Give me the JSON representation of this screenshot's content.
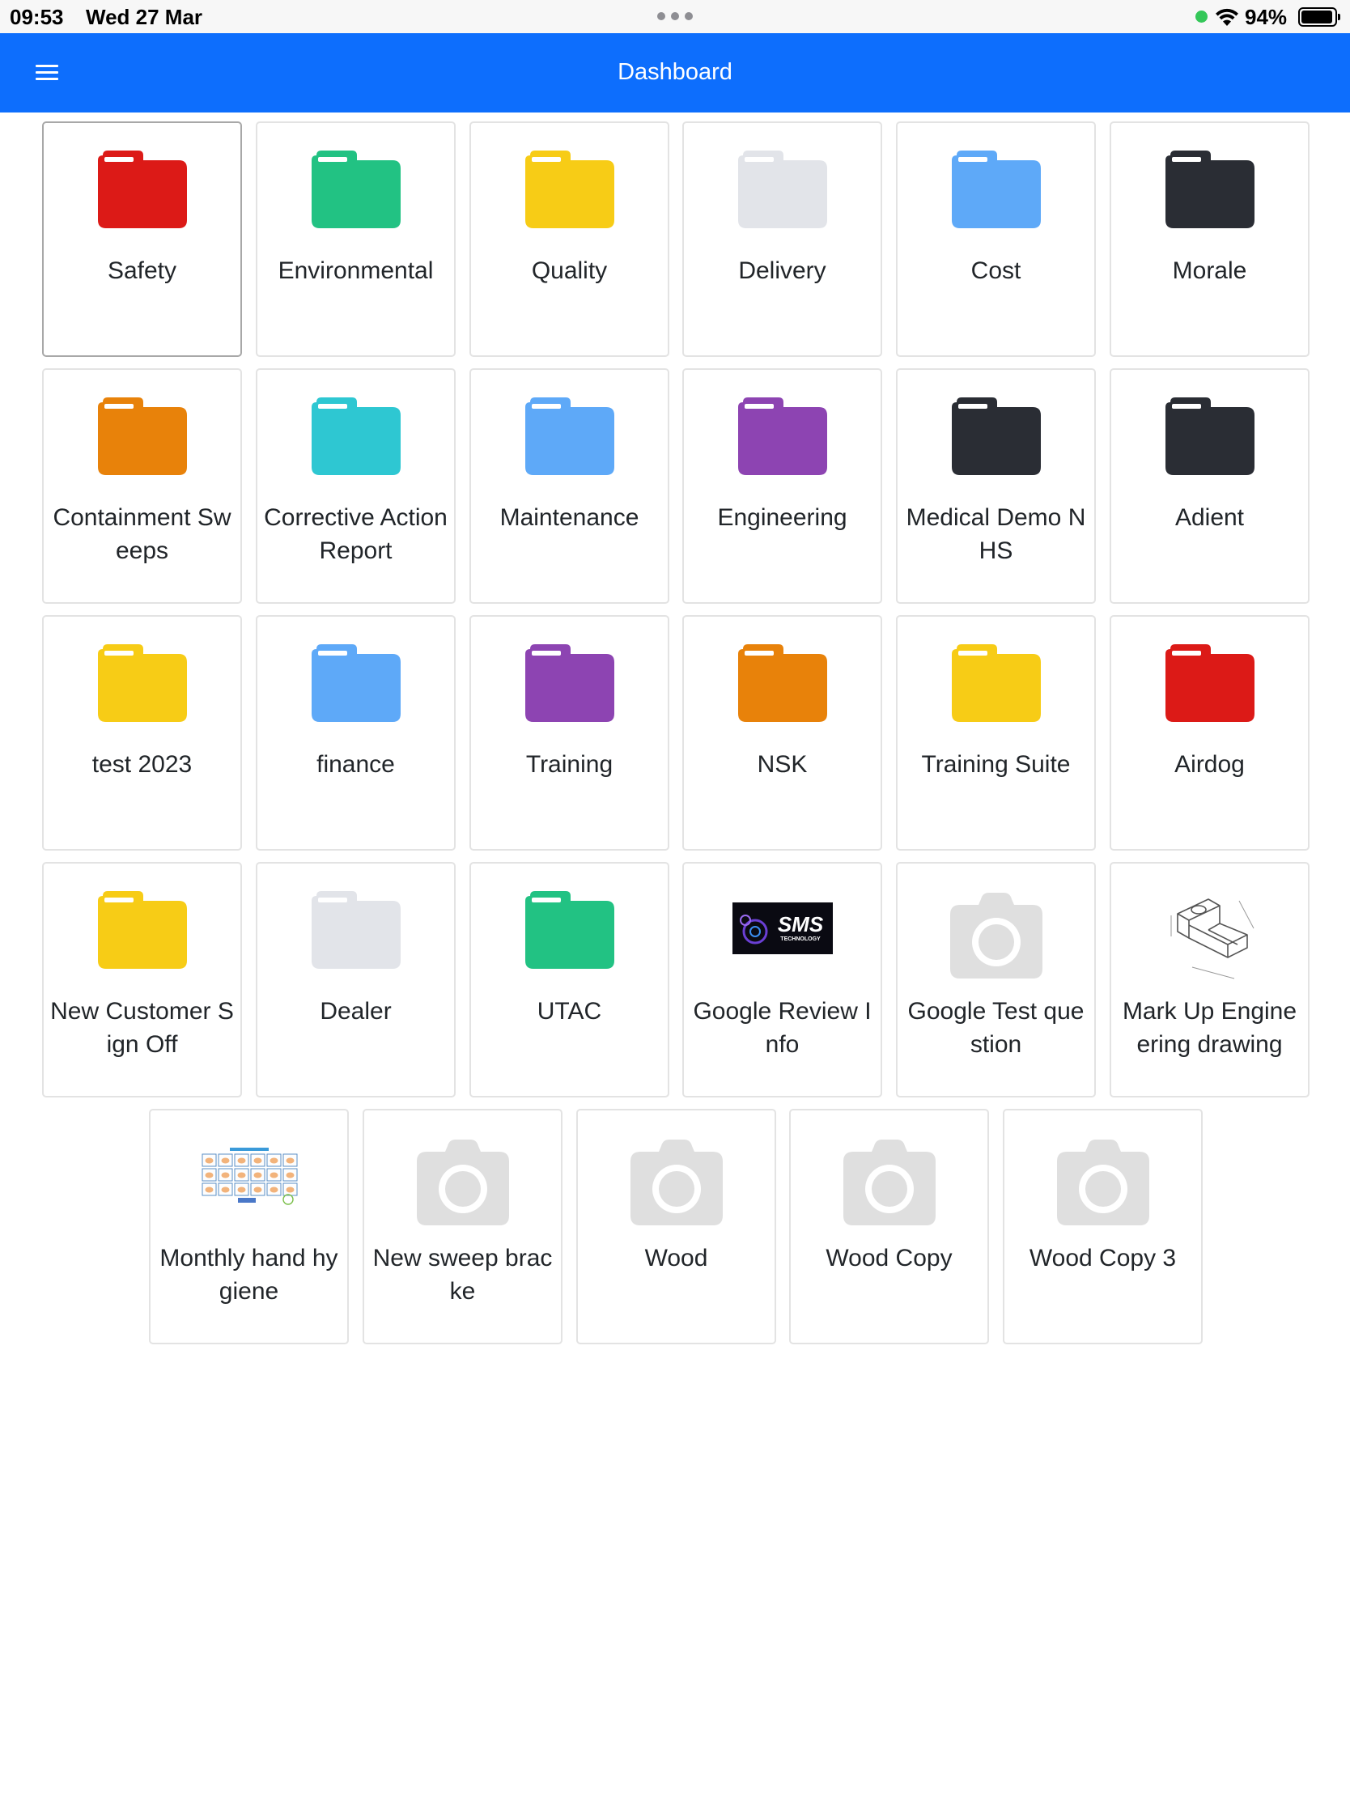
{
  "status_bar": {
    "time": "09:53",
    "date": "Wed 27 Mar",
    "battery": "94%",
    "battery_level": 0.94
  },
  "navbar": {
    "menu_icon": "hamburger-menu-icon",
    "title": "Dashboard",
    "color": "#0d6efd"
  },
  "tiles": [
    {
      "label": "Safety",
      "icon": "folder-icon",
      "color": "#dc1a17"
    },
    {
      "label": "Environmental",
      "icon": "folder-icon",
      "color": "#22c283"
    },
    {
      "label": "Quality",
      "icon": "folder-icon",
      "color": "#f7cc16"
    },
    {
      "label": "Delivery",
      "icon": "folder-icon",
      "color": "#e2e4e9"
    },
    {
      "label": "Cost",
      "icon": "folder-icon",
      "color": "#5ea9f8"
    },
    {
      "label": "Morale",
      "icon": "folder-icon",
      "color": "#2a2d34"
    },
    {
      "label": "Containment Sweeps",
      "icon": "folder-icon",
      "color": "#e8820a"
    },
    {
      "label": "Corrective Action Report",
      "icon": "folder-icon",
      "color": "#2ec7d2"
    },
    {
      "label": "Maintenance",
      "icon": "folder-icon",
      "color": "#5ea9f8"
    },
    {
      "label": "Engineering",
      "icon": "folder-icon",
      "color": "#8d44b2"
    },
    {
      "label": "Medical Demo NHS",
      "icon": "folder-icon",
      "color": "#2a2d34"
    },
    {
      "label": "Adient",
      "icon": "folder-icon",
      "color": "#2a2d34"
    },
    {
      "label": "test 2023",
      "icon": "folder-icon",
      "color": "#f7cc16"
    },
    {
      "label": "finance",
      "icon": "folder-icon",
      "color": "#5ea9f8"
    },
    {
      "label": "Training",
      "icon": "folder-icon",
      "color": "#8d44b2"
    },
    {
      "label": "NSK",
      "icon": "folder-icon",
      "color": "#e8820a"
    },
    {
      "label": "Training Suite",
      "icon": "folder-icon",
      "color": "#f7cc16"
    },
    {
      "label": "Airdog",
      "icon": "folder-icon",
      "color": "#dc1a17"
    },
    {
      "label": "New Customer Sign Off",
      "icon": "folder-icon",
      "color": "#f7cc16"
    },
    {
      "label": "Dealer",
      "icon": "folder-icon",
      "color": "#e2e4e9"
    },
    {
      "label": "UTAC",
      "icon": "folder-icon",
      "color": "#22c283"
    },
    {
      "label": "Google Review Info",
      "icon": "sms-technology-logo-image",
      "logo_text": "SMS",
      "logo_subtext": "TECHNOLOGY"
    },
    {
      "label": "Google Test question",
      "icon": "camera-placeholder-icon"
    },
    {
      "label": "Mark Up Engineering drawing",
      "icon": "engineering-drawing-image"
    },
    {
      "label": "Monthly hand hygiene",
      "icon": "handwashing-poster-image"
    },
    {
      "label": "New sweep bracke",
      "icon": "camera-placeholder-icon"
    },
    {
      "label": "Wood",
      "icon": "camera-placeholder-icon"
    },
    {
      "label": "Wood Copy",
      "icon": "camera-placeholder-icon"
    },
    {
      "label": "Wood Copy 3",
      "icon": "camera-placeholder-icon"
    }
  ]
}
